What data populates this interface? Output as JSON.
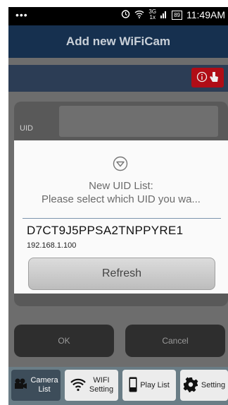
{
  "status_bar": {
    "dots": "•••",
    "time": "11:49AM",
    "battery": "89",
    "network_top": "3G",
    "network_bottom": "1x"
  },
  "title_bar": {
    "title": "Add new WiFiCam"
  },
  "info_button": {
    "icon": "info-icon"
  },
  "form": {
    "uid_label": "UID"
  },
  "buttons": {
    "ok": "OK",
    "cancel": "Cancel"
  },
  "bottom_nav": {
    "items": [
      {
        "label_line1": "Camera",
        "label_line2": "List",
        "icon": "camera-icon",
        "active": true
      },
      {
        "label_line1": "WIFI",
        "label_line2": "Setting",
        "icon": "wifi-icon",
        "active": false
      },
      {
        "label_line1": "Play List",
        "label_line2": "",
        "icon": "phone-icon",
        "active": false
      },
      {
        "label_line1": "Setting",
        "label_line2": "",
        "icon": "gear-icon",
        "active": false
      }
    ]
  },
  "dialog": {
    "title_line1": "New UID List:",
    "title_line2": "Please select which UID you wa...",
    "uid": "D7CT9J5PPSA2TNPPYRE1",
    "ip": "192.168.1.100",
    "refresh_label": "Refresh"
  },
  "colors": {
    "title_bar_bg": "#16304f",
    "info_button_bg": "#b00d16",
    "dialog_bg": "#fafafa",
    "separator": "#7d95ad"
  }
}
